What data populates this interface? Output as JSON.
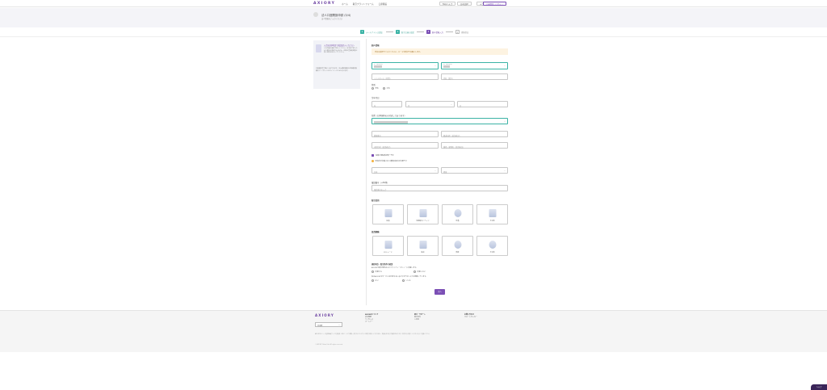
{
  "header": {
    "logo": "AXIORY",
    "nav": [
      "ホーム",
      "取引プラットフォーム",
      "口座開設"
    ],
    "buttons": {
      "faq": "FAQ/ヘルプ",
      "lang": "日本語/JP",
      "chat": "メニュー",
      "signup": "口座開設／ログイン"
    }
  },
  "hero": {
    "title": "法人口座開設申請 (5/4)",
    "subtitle": "法人情報をご入力ください"
  },
  "steps": [
    {
      "num": "1",
      "label": "メールアドレス認証"
    },
    {
      "num": "2",
      "label": "取引口座の設定"
    },
    {
      "num": "3",
      "label": "個人情報入力"
    },
    {
      "num": "4",
      "label": "書類提出"
    }
  ],
  "side": {
    "heading": "入力は日本語で英語記入ください",
    "body": "入力内容は英語で記入ください。日本語で記入された場合は承認されません。住所は登録証明書と同じ住所を記入してください。",
    "note": "口座開設完了後に入金できます。本人確認書類と住所確認書類のアップロードはマイページからも行えます。"
  },
  "form": {
    "section_title": "個人情報",
    "banner": "氏名は英語でご入力ください。ローマ字表記でお願いします。",
    "first_name_label": "名（英語表記）",
    "last_name_label": "姓（英語表記）",
    "middle_name_ph": "ミドルネーム（任意）",
    "nickname_ph": "氏名（漢字）",
    "gender_label": "性別",
    "gender_options": [
      "男性",
      "女性"
    ],
    "dob_label": "生年月日",
    "dob": {
      "year": "年",
      "month": "月",
      "day": "日"
    },
    "address_label": "住所（日本国内のみ対応しております）",
    "postal_ph": "郵便番号",
    "pref_ph": "都道府県（英語表記）",
    "city_ph": "市区町村（英語表記）",
    "street_ph": "番地・建物名（英語表記）",
    "same_address_label": "住所と現住所が同一です",
    "warn_text": "現住所が記載された書類の提出が必要です",
    "country_ph": "日本",
    "region_ph": "地域",
    "phone_label": "電話番号（+81等）",
    "phone_ph": "電話番号を入力",
    "purpose_label": "取引目的",
    "purpose_cards": [
      "投資",
      "短期取引／ヘッジ",
      "貯蓄",
      "その他"
    ],
    "experience_label": "投資経験",
    "experience_cards": [
      "FXトレード",
      "株式",
      "債券",
      "その他"
    ],
    "consent_label": "規約同意・取引条件の確認",
    "consent_text": "AXIORYの取引規約およびプライバシーポリシーに同意します。",
    "consent_options": [
      "同意する",
      "同意しない"
    ],
    "agree_text": "私はAXIORYのサービスを利用するにあたり全てのリスクを理解しています。",
    "agree_options": [
      "はい",
      "いいえ"
    ],
    "submit": "次へ"
  },
  "footer": {
    "logo": "AXIORY",
    "lang_select": "日本語",
    "cols": [
      {
        "heading": "AXIORYについて",
        "items": [
          "会社概要",
          "ライセンス",
          "パートナー"
        ]
      },
      {
        "heading": "取引・サポート",
        "items": [
          "取引条件",
          "入出金"
        ]
      },
      {
        "heading": "お問い合わせ",
        "items": [
          "サポートセンター"
        ]
      }
    ],
    "legal": "AXIORYはベリーズ国際金融サービス委員会（IFSC）により規制・認可されています。FX取引は高いリスクを伴い、投資元本を失う可能性があります。取引を行う前にリスクを十分にご理解ください。",
    "copyright": "© AXIORY Global Ltd. All rights reserved."
  },
  "chat_button": "ヘルプ"
}
